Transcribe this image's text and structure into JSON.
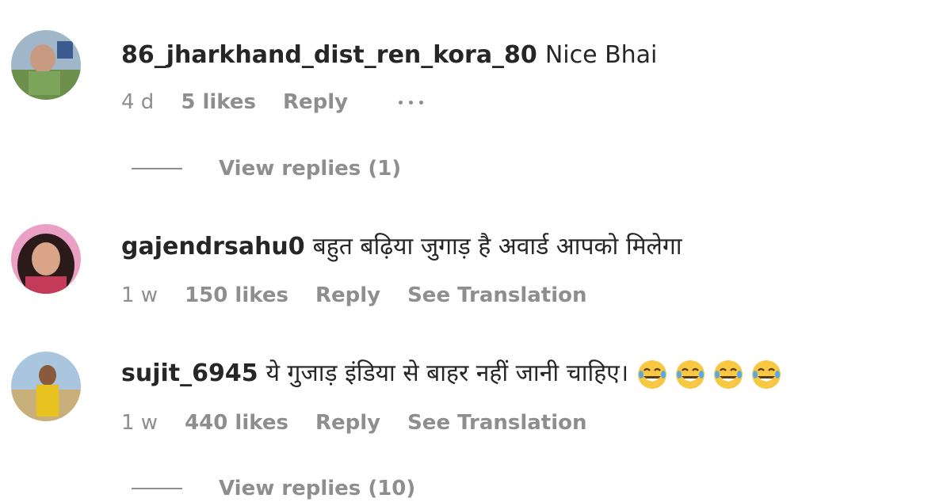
{
  "comments": [
    {
      "username": "86_jharkhand_dist_ren_kora_80",
      "text": "Nice Bhai",
      "time": "4 d",
      "likes": "5 likes",
      "reply": "Reply",
      "view_replies": "View replies (1)"
    },
    {
      "username": "gajendrsahu0",
      "text": "बहुत बढ़िया जुगाड़ है अवार्ड आपको मिलेगा",
      "time": "1 w",
      "likes": "150 likes",
      "reply": "Reply",
      "see_translation": "See Translation"
    },
    {
      "username": "sujit_6945",
      "text": "ये गुजाड़ इंडिया से बाहर नहीं जानी चाहिए।",
      "emoji_name": "face-with-tears-of-joy-emoji",
      "emoji_count": 4,
      "time": "1 w",
      "likes": "440 likes",
      "reply": "Reply",
      "see_translation": "See Translation",
      "view_replies": "View replies (10)"
    }
  ],
  "icons": {
    "more_options": "more-horizontal-icon"
  },
  "colors": {
    "primary_text": "#262626",
    "secondary_text": "#8e8e8e",
    "background": "#ffffff",
    "emoji_face": "#f7c844"
  }
}
